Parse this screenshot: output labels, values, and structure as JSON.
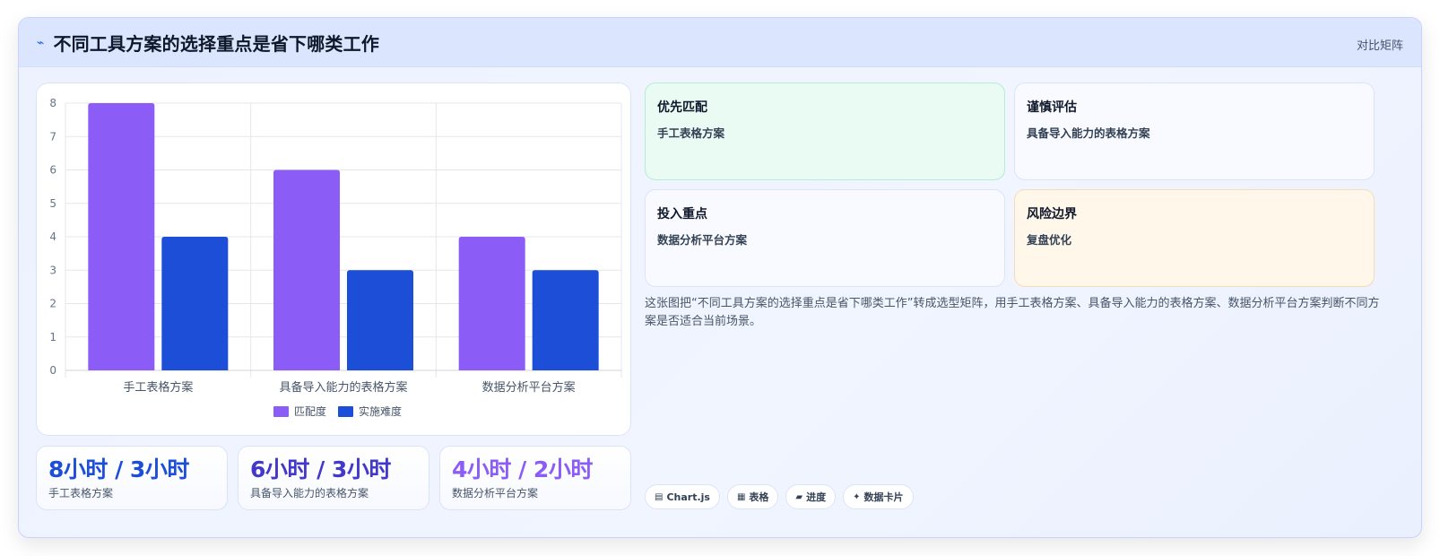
{
  "header": {
    "icon": "trend-icon",
    "title": "不同工具方案的选择重点是省下哪类工作",
    "tag": "对比矩阵"
  },
  "chart_data": {
    "type": "bar",
    "categories": [
      "手工表格方案",
      "具备导入能力的表格方案",
      "数据分析平台方案"
    ],
    "series": [
      {
        "name": "匹配度",
        "values": [
          8,
          6,
          4
        ],
        "color": "#8b5cf6"
      },
      {
        "name": "实施难度",
        "values": [
          4,
          3,
          3
        ],
        "color": "#1d4ed8"
      }
    ],
    "ylim": [
      0,
      8
    ],
    "yticks": [
      "0",
      "1",
      "2",
      "3",
      "4",
      "5",
      "6",
      "7",
      "8"
    ],
    "grid": true,
    "legend": "bottom"
  },
  "stats": [
    {
      "value": "8小时 / 3小时",
      "label": "手工表格方案",
      "color": "#1d4ed8"
    },
    {
      "value": "6小时 / 3小时",
      "label": "具备导入能力的表格方案",
      "color": "#4338ca"
    },
    {
      "value": "4小时 / 2小时",
      "label": "数据分析平台方案",
      "color": "#8b5cf6"
    }
  ],
  "matrix": [
    {
      "title": "优先匹配",
      "sub": "手工表格方案",
      "bg": "#e9fbf3",
      "border": "#b7ebd2"
    },
    {
      "title": "谨慎评估",
      "sub": "具备导入能力的表格方案",
      "bg": "#f8faff",
      "border": "#dbe4f7"
    },
    {
      "title": "投入重点",
      "sub": "数据分析平台方案",
      "bg": "#f8faff",
      "border": "#dbe4f7"
    },
    {
      "title": "风险边界",
      "sub": "复盘优化",
      "bg": "#fff7ea",
      "border": "#f4dcb4"
    }
  ],
  "description": "这张图把“不同工具方案的选择重点是省下哪类工作”转成选型矩阵，用手工表格方案、具备导入能力的表格方案、数据分析平台方案判断不同方案是否适合当前场景。",
  "tags": [
    {
      "icon": "▤",
      "icon_name": "chart-icon",
      "label": "Chart.js"
    },
    {
      "icon": "▦",
      "icon_name": "table-icon",
      "label": "表格"
    },
    {
      "icon": "▰",
      "icon_name": "progress-icon",
      "label": "进度"
    },
    {
      "icon": "✦",
      "icon_name": "sparkle-icon",
      "label": "数据卡片"
    }
  ]
}
